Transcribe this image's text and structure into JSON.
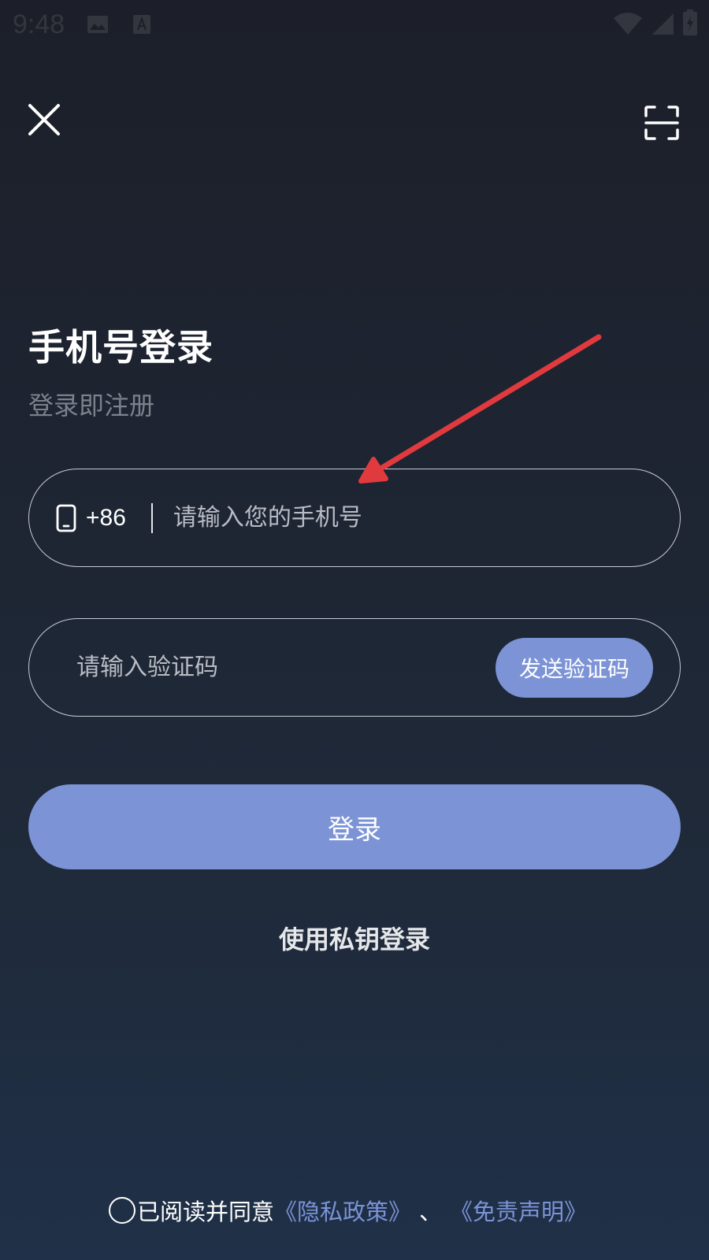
{
  "status_bar": {
    "time": "9:48",
    "icons": [
      "image-icon",
      "font-icon",
      "wifi-icon",
      "signal-icon",
      "battery-icon"
    ]
  },
  "header": {
    "close_icon": "close-icon",
    "scan_icon": "scan-icon"
  },
  "title": "手机号登录",
  "subtitle": "登录即注册",
  "phone": {
    "country_code": "+86",
    "placeholder": "请输入您的手机号",
    "value": ""
  },
  "code": {
    "placeholder": "请输入验证码",
    "value": "",
    "send_label": "发送验证码"
  },
  "login_label": "登录",
  "private_key_login_label": "使用私钥登录",
  "agreement": {
    "prefix": "已阅读并同意",
    "privacy_policy": "《隐私政策》",
    "separator": "、",
    "disclaimer": "《免责声明》"
  },
  "colors": {
    "accent": "#7c93d6",
    "background_top": "#1c1f29",
    "background_bottom": "#1f3048",
    "annotation_arrow": "#e03a3e"
  }
}
